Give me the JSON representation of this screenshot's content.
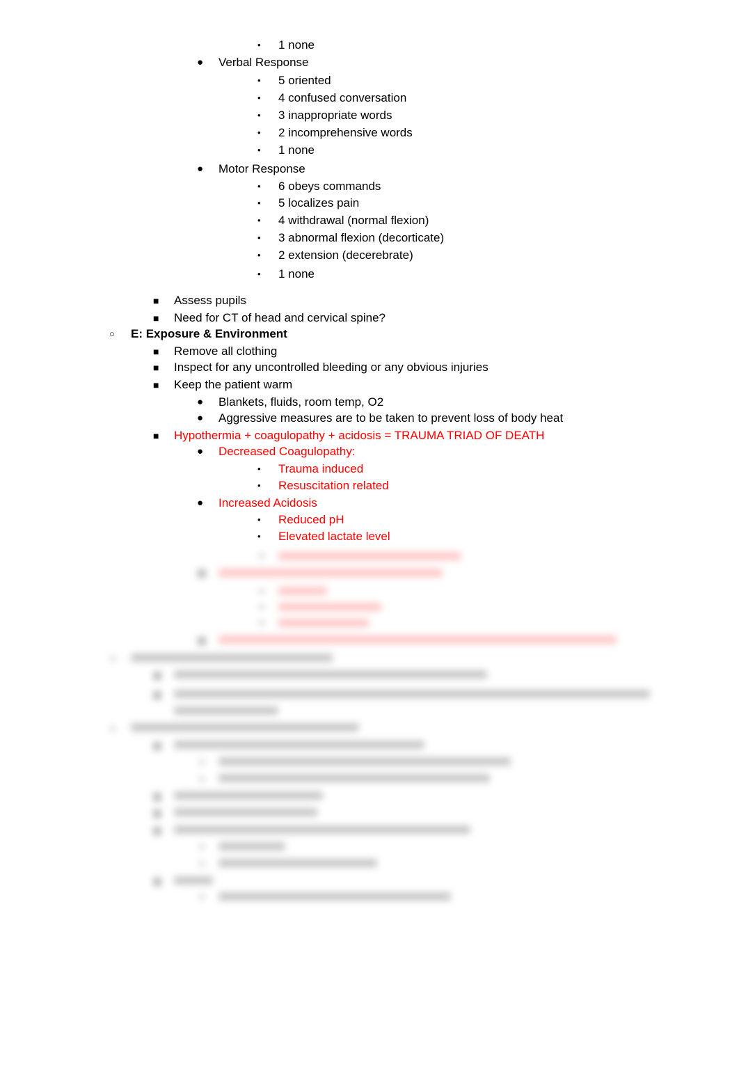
{
  "document": {
    "items": [
      {
        "level": 3,
        "bullet": "•",
        "text": "1 none",
        "color": "#000000"
      },
      {
        "level": 2,
        "bullet": "●",
        "text": "Verbal Response",
        "color": "#000000"
      },
      {
        "level": 3,
        "bullet": "•",
        "text": "5 oriented",
        "color": "#000000"
      },
      {
        "level": 3,
        "bullet": "•",
        "text": "4 confused conversation",
        "color": "#000000"
      },
      {
        "level": 3,
        "bullet": "•",
        "text": "3 inappropriate words",
        "color": "#000000"
      },
      {
        "level": 3,
        "bullet": "•",
        "text": "2 incomprehensive words",
        "color": "#000000"
      },
      {
        "level": 3,
        "bullet": "•",
        "text": "1 none",
        "color": "#000000"
      },
      {
        "level": 2,
        "bullet": "●",
        "text": "Motor Response",
        "color": "#000000"
      },
      {
        "level": 3,
        "bullet": "•",
        "text": "6 obeys commands",
        "color": "#000000"
      },
      {
        "level": 3,
        "bullet": "•",
        "text": "5 localizes pain",
        "color": "#000000"
      },
      {
        "level": 3,
        "bullet": "•",
        "text": "4 withdrawal (normal flexion)",
        "color": "#000000"
      },
      {
        "level": 3,
        "bullet": "•",
        "text": "3 abnormal flexion (decorticate)",
        "color": "#000000"
      },
      {
        "level": 3,
        "bullet": "•",
        "text": "2 extension (decerebrate)",
        "color": "#000000"
      },
      {
        "level": 3,
        "bullet": "•",
        "text": "1 none",
        "color": "#000000"
      },
      {
        "level": 1,
        "bullet": "■",
        "text": "Assess pupils",
        "color": "#000000"
      },
      {
        "level": 1,
        "bullet": "■",
        "text": "Need for CT of head and cervical spine?",
        "color": "#000000"
      },
      {
        "level": 0,
        "bullet": "○",
        "text": "E: Exposure & Environment",
        "color": "#000000",
        "bold": true
      },
      {
        "level": 1,
        "bullet": "■",
        "text": "Remove all clothing",
        "color": "#000000"
      },
      {
        "level": 1,
        "bullet": "■",
        "text": "Inspect for any uncontrolled bleeding or any obvious injuries",
        "color": "#000000"
      },
      {
        "level": 1,
        "bullet": "■",
        "text": "Keep the patient warm",
        "color": "#000000"
      },
      {
        "level": 2,
        "bullet": "●",
        "text": "Blankets, fluids, room temp, O2",
        "color": "#000000"
      },
      {
        "level": 2,
        "bullet": "●",
        "text": "Aggressive measures are to be taken to prevent loss of body heat",
        "color": "#000000"
      },
      {
        "level": 1,
        "bullet": "■",
        "text": "Hypothermia + coagulopathy + acidosis = TRAUMA TRIAD OF DEATH",
        "color": "#ff0000"
      },
      {
        "level": 2,
        "bullet": "●",
        "text": "Decreased Coagulopathy:",
        "color": "#ff0000"
      },
      {
        "level": 3,
        "bullet": "•",
        "text": "Trauma induced",
        "color": "#ff0000"
      },
      {
        "level": 3,
        "bullet": "•",
        "text": "Resuscitation related",
        "color": "#ff0000"
      },
      {
        "level": 2,
        "bullet": "●",
        "text": "Increased Acidosis",
        "color": "#ff0000"
      },
      {
        "level": 3,
        "bullet": "•",
        "text": "Reduced pH",
        "color": "#ff0000"
      },
      {
        "level": 3,
        "bullet": "•",
        "text": "Elevated lactate level",
        "color": "#ff0000"
      }
    ],
    "blurred_notice": "remaining content blurred"
  }
}
